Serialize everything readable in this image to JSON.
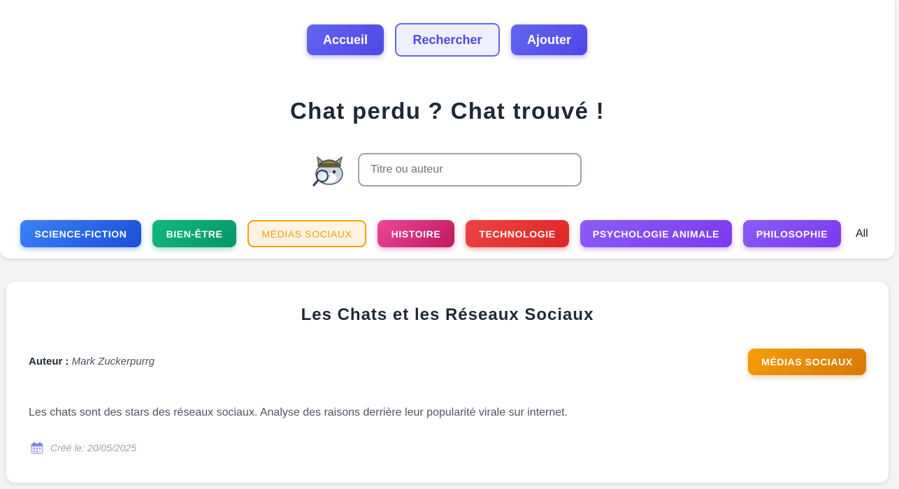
{
  "nav": {
    "home": "Accueil",
    "search": "Rechercher",
    "add": "Ajouter"
  },
  "page_title": "Chat perdu ? Chat trouvé !",
  "search": {
    "placeholder": "Titre ou auteur",
    "value": "",
    "mascot_icon": "detective-cat-icon"
  },
  "categories": [
    {
      "label": "SCIENCE-FICTION",
      "color": "#2563eb",
      "active": false
    },
    {
      "label": "BIEN-ÊTRE",
      "color": "#059669",
      "active": false
    },
    {
      "label": "MÉDIAS SOCIAUX",
      "color": "#f59e0b",
      "active": true
    },
    {
      "label": "HISTOIRE",
      "color": "#db2777",
      "active": false
    },
    {
      "label": "TECHNOLOGIE",
      "color": "#dc2626",
      "active": false
    },
    {
      "label": "PSYCHOLOGIE ANIMALE",
      "color": "#7c3aed",
      "active": false
    },
    {
      "label": "PHILOSOPHIE",
      "color": "#7c3aed",
      "active": false
    }
  ],
  "all_filter": "All",
  "article": {
    "title": "Les Chats et les Réseaux Sociaux",
    "author_label": "Auteur :",
    "author": "Mark Zuckerpurrg",
    "category": "MÉDIAS SOCIAUX",
    "description": "Les chats sont des stars des réseaux sociaux. Analyse des raisons derrière leur popularité virale sur internet.",
    "created": "Créé le: 20/05/2025",
    "created_icon": "calendar-icon"
  },
  "colors": {
    "primary": "#4f46e5",
    "text": "#1f2937",
    "muted": "#4b5563"
  }
}
